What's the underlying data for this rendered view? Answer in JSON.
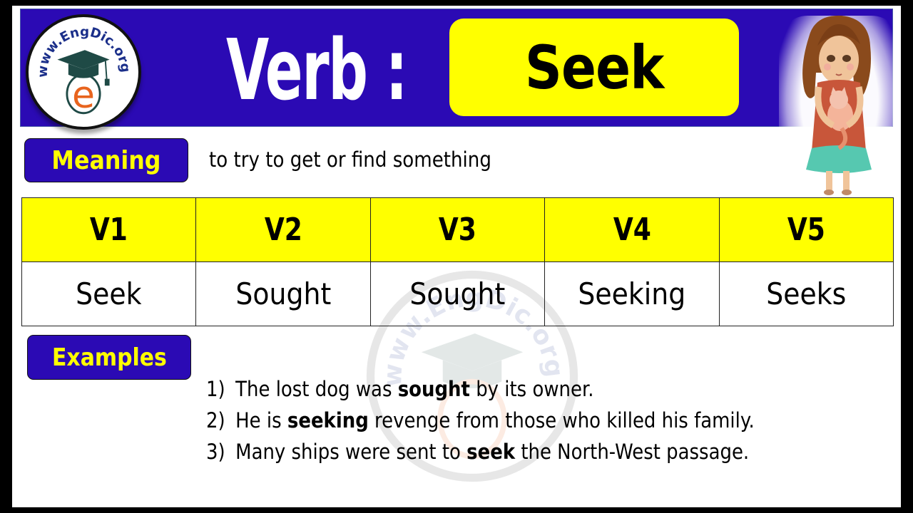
{
  "brand": {
    "logo_text": "www.EngDic.org",
    "logo_letter": "e",
    "watermark_text": "www.EngDic.org"
  },
  "header": {
    "label": "Verb :",
    "word": "Seek"
  },
  "meaning": {
    "label": "Meaning",
    "text": "to try to get or find something"
  },
  "forms_table": {
    "headers": [
      "V1",
      "V2",
      "V3",
      "V4",
      "V5"
    ],
    "values": [
      "Seek",
      "Sought",
      "Sought",
      "Seeking",
      "Seeks"
    ]
  },
  "examples": {
    "label": "Examples",
    "items": [
      {
        "num": "1)",
        "before": "The lost dog was ",
        "bold": "sought",
        "after": " by its owner."
      },
      {
        "num": "2)",
        "before": "He is ",
        "bold": "seeking",
        "after": " revenge from those who killed his family."
      },
      {
        "num": "3)",
        "before": "Many ships were sent to ",
        "bold": "seek",
        "after": " the North-West passage."
      }
    ]
  },
  "colors": {
    "banner": "#2b0ab4",
    "highlight": "#ffff00",
    "logo_blue": "#1b2f8a",
    "logo_orange": "#e8641e",
    "cap_green": "#1f4a46"
  },
  "illustration": "girl-holding-cat"
}
